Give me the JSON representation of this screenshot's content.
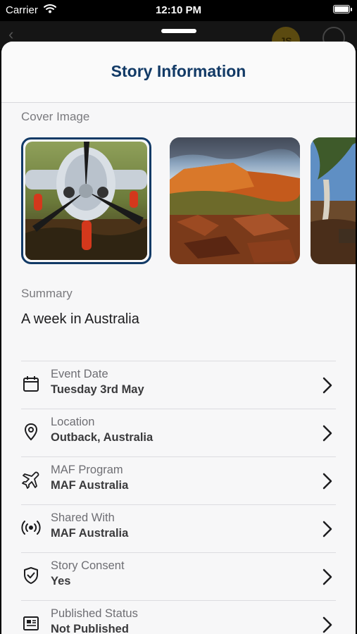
{
  "status_bar": {
    "carrier": "Carrier",
    "time": "12:10 PM"
  },
  "background_nav": {
    "avatar_initials": "JS"
  },
  "sheet": {
    "title": "Story Information",
    "cover_section_label": "Cover Image",
    "summary_label": "Summary",
    "summary_value": "A week in Australia"
  },
  "covers": [
    {
      "name": "cover-plane",
      "selected": true
    },
    {
      "name": "cover-outback-cliff",
      "selected": false
    },
    {
      "name": "cover-river-gum",
      "selected": false
    }
  ],
  "details": [
    {
      "label": "Event Date",
      "value": "Tuesday 3rd May",
      "icon": "calendar-icon"
    },
    {
      "label": "Location",
      "value": "Outback, Australia",
      "icon": "location-pin-icon"
    },
    {
      "label": "MAF Program",
      "value": "MAF Australia",
      "icon": "airplane-icon"
    },
    {
      "label": "Shared With",
      "value": "MAF Australia",
      "icon": "broadcast-icon"
    },
    {
      "label": "Story Consent",
      "value": "Yes",
      "icon": "shield-check-icon"
    },
    {
      "label": "Published Status",
      "value": "Not Published",
      "icon": "newspaper-icon"
    }
  ],
  "colors": {
    "accent": "#123a66",
    "sheet_background": "#f7f7f8",
    "divider": "#dcdce0"
  }
}
